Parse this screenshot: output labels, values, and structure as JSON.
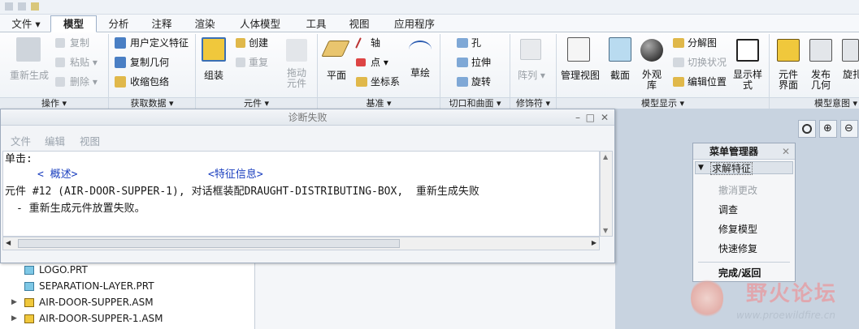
{
  "tabs": [
    {
      "label": "文件",
      "has_dropdown": true
    },
    {
      "label": "模型",
      "active": true
    },
    {
      "label": "分析"
    },
    {
      "label": "注释"
    },
    {
      "label": "渲染"
    },
    {
      "label": "人体模型"
    },
    {
      "label": "工具"
    },
    {
      "label": "视图"
    },
    {
      "label": "应用程序"
    }
  ],
  "ribbon": {
    "groups": {
      "operations": "操作",
      "get_data": "获取数据",
      "components": "元件",
      "datum": "基准",
      "cut_surface": "切口和曲面",
      "modifiers": "修饰符",
      "model_display": "模型显示",
      "model_intent": "模型意图"
    },
    "regenerate": "重新生成",
    "copy": "复制",
    "paste": "粘贴",
    "delete": "删除",
    "udf": "用户定义特征",
    "copy_geometry": "复制几何",
    "shrinkwrap": "收缩包络",
    "assemble": "组装",
    "create": "创建",
    "repeat": "重复",
    "drag_components": [
      "拖动",
      "元件"
    ],
    "plane": "平面",
    "axis": "轴",
    "point": "点",
    "csys": "坐标系",
    "sketch": "草绘",
    "hole": "孔",
    "extrude": "拉伸",
    "revolve": "旋转",
    "pattern": "阵列",
    "manage_views": "管理视图",
    "section": "截面",
    "appearance": [
      "外观",
      "库"
    ],
    "exploded_view": "分解图",
    "toggle_status": "切换状况",
    "edit_position": "编辑位置",
    "display_style": [
      "显示样",
      "式"
    ],
    "component_interface": [
      "元件",
      "界面"
    ],
    "publish_geometry": [
      "发布",
      "几何"
    ],
    "cut_off": "旋扎"
  },
  "dialog": {
    "title": "诊断失败",
    "menu": [
      "文件",
      "编辑",
      "视图"
    ],
    "click_label": "单击:",
    "link_summary": "< 概述>",
    "link_feature_info": "<特征信息>",
    "error_line": "元件 #12 (AIR-DOOR-SUPPER-1), 对话框装配DRAUGHT-DISTRIBUTING-BOX,  重新生成失败",
    "detail_line": "- 重新生成元件放置失败。"
  },
  "tree": [
    {
      "name": "LOGO.PRT",
      "type": "part",
      "expandable": false
    },
    {
      "name": "SEPARATION-LAYER.PRT",
      "type": "part",
      "expandable": false
    },
    {
      "name": "AIR-DOOR-SUPPER.ASM",
      "type": "assembly",
      "expandable": true
    },
    {
      "name": "AIR-DOOR-SUPPER-1.ASM",
      "type": "assembly",
      "expandable": true
    }
  ],
  "menu_manager": {
    "title": "菜单管理器",
    "section": "求解特征",
    "items": [
      {
        "label": "撤消更改",
        "enabled": false
      },
      {
        "label": "调查",
        "enabled": true
      },
      {
        "label": "修复模型",
        "enabled": true
      },
      {
        "label": "快速修复",
        "enabled": true
      }
    ],
    "done_return": "完成/返回"
  },
  "watermark": {
    "cn": "野火论坛",
    "url": "www.proewildfire.cn"
  },
  "colors": {
    "accent_blue": "#1a3fbf",
    "viewport_bg": "#c8d3e0",
    "ribbon_bg": "#eef2f6"
  }
}
